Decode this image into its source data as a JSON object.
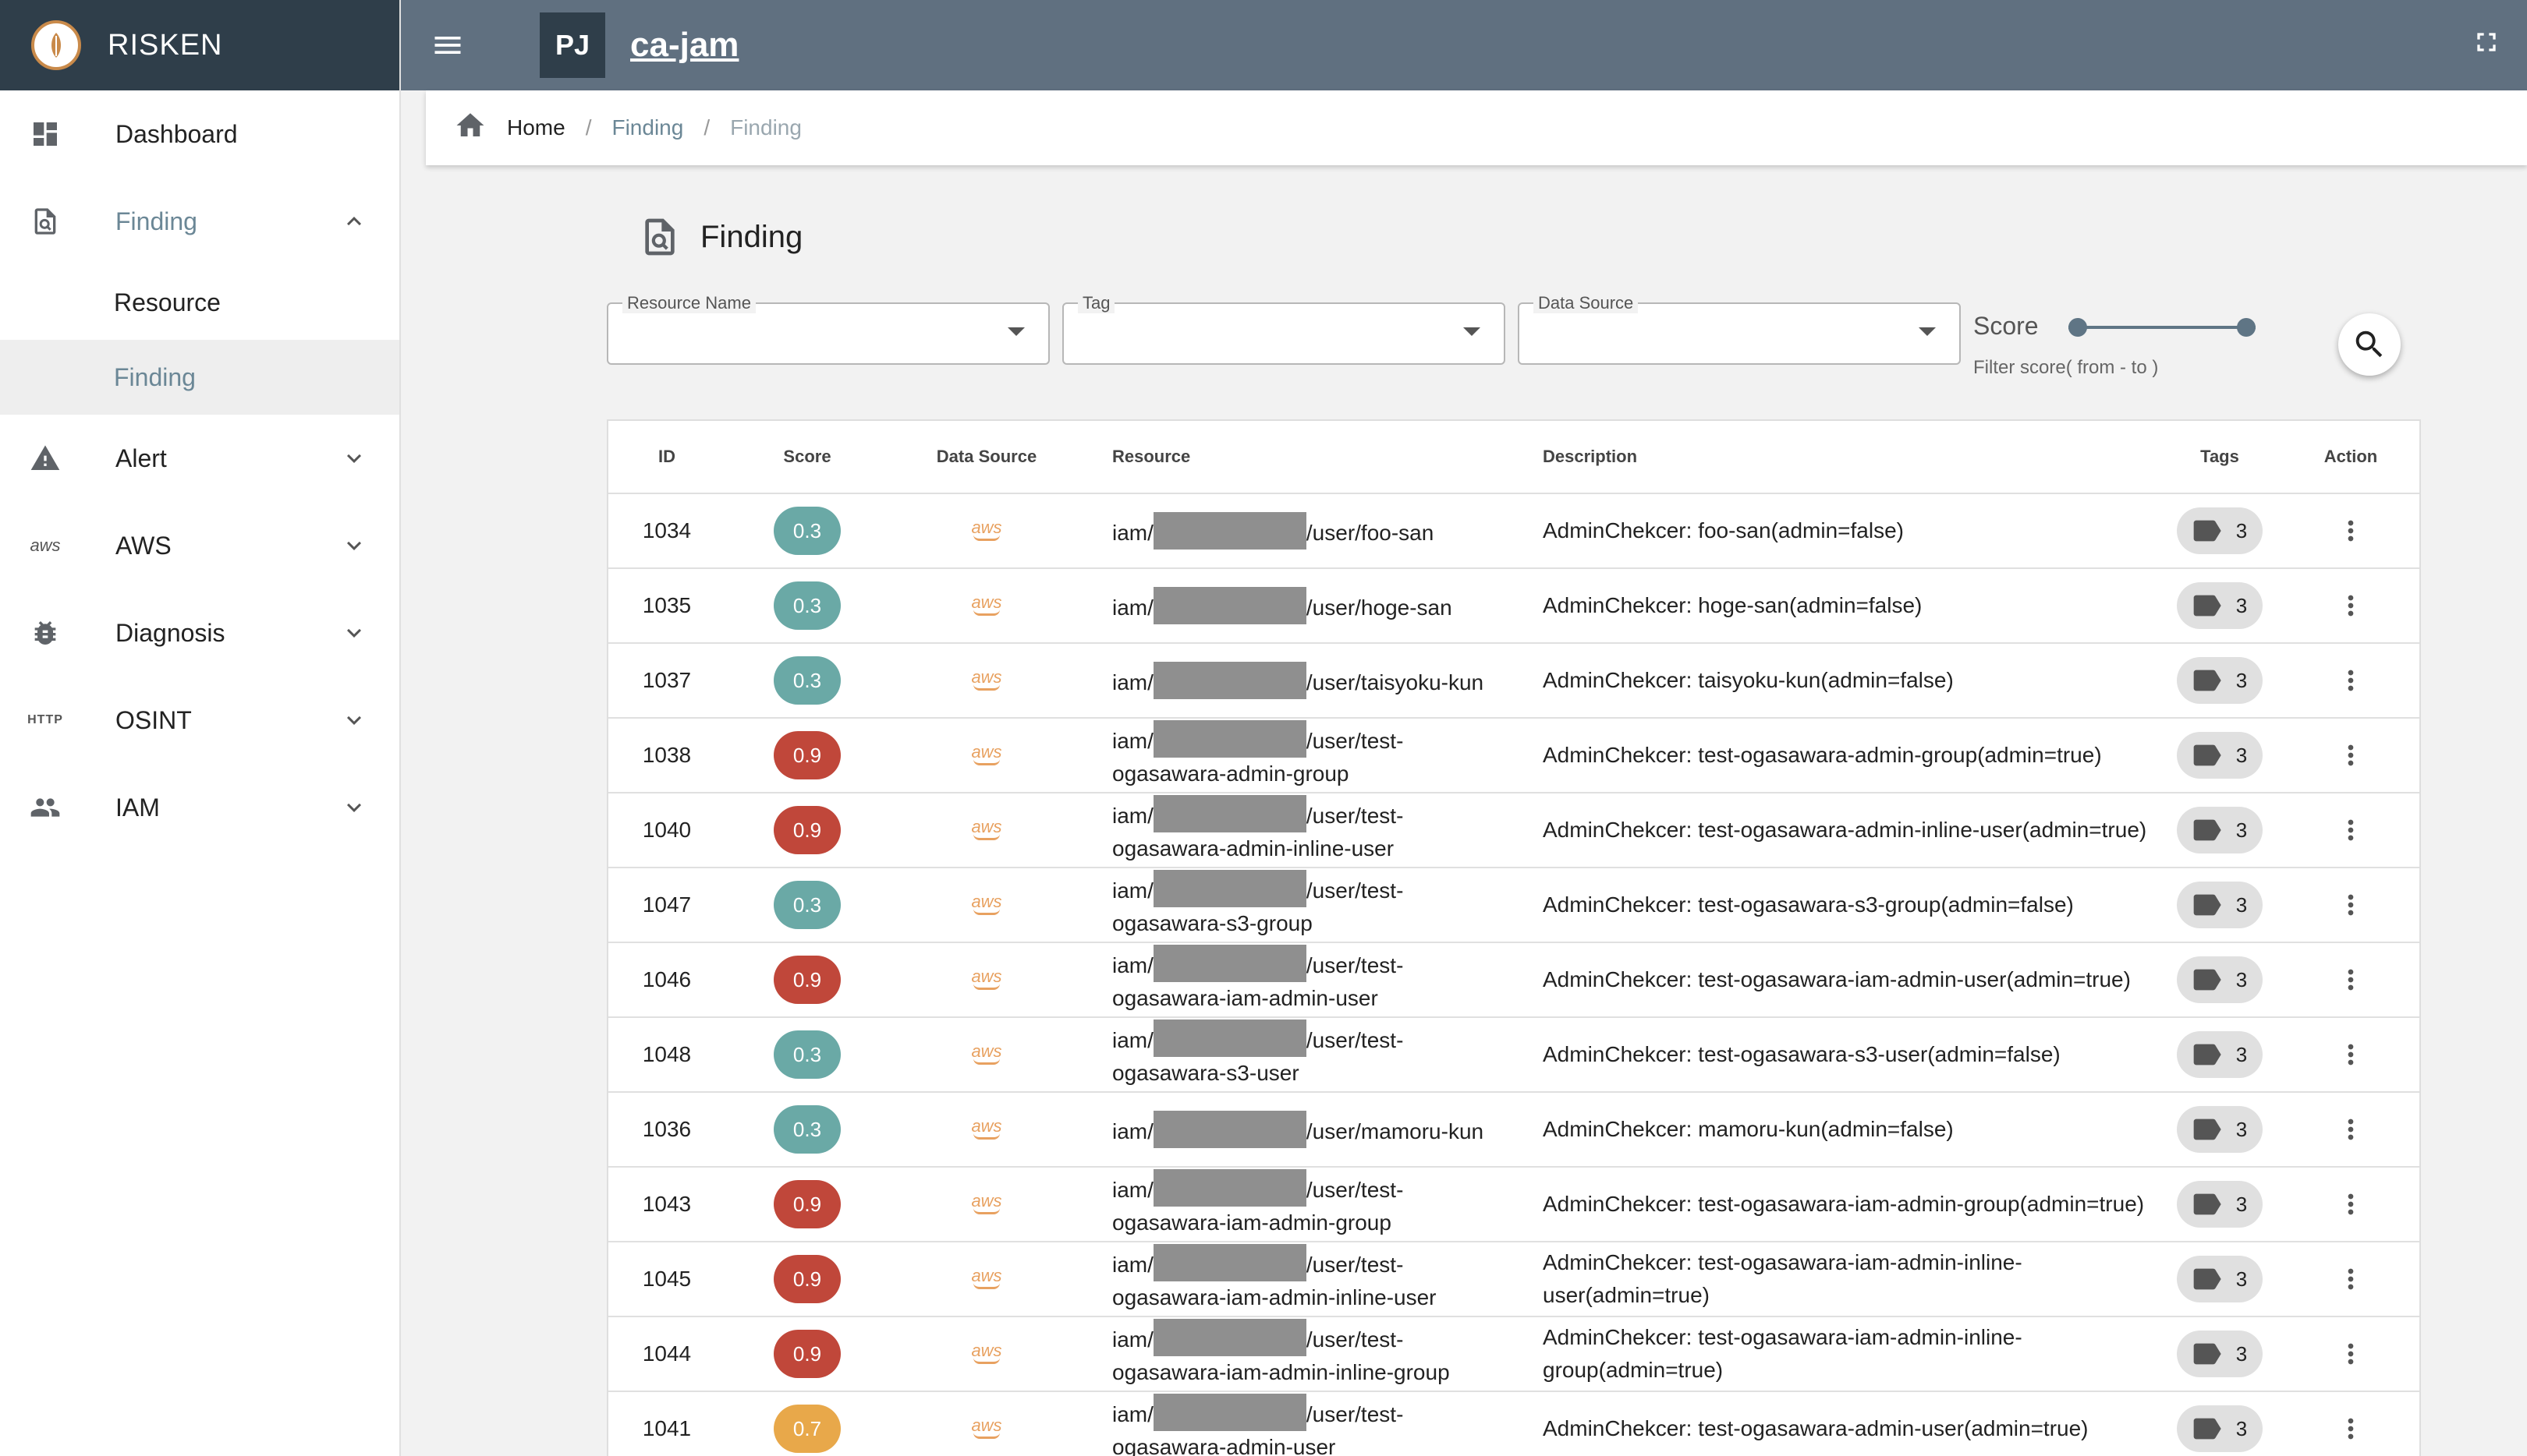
{
  "app": {
    "name": "RISKEN"
  },
  "topbar": {
    "project_badge": "PJ",
    "project_name": "ca-jam"
  },
  "sidebar": {
    "items": [
      {
        "label": "Dashboard",
        "icon": "dashboard-icon"
      },
      {
        "label": "Finding",
        "icon": "finding-icon",
        "expanded": true,
        "children": [
          {
            "label": "Resource"
          },
          {
            "label": "Finding",
            "selected": true
          }
        ]
      },
      {
        "label": "Alert",
        "icon": "warning-icon"
      },
      {
        "label": "AWS",
        "icon": "aws-icon",
        "icon_text": "aws"
      },
      {
        "label": "Diagnosis",
        "icon": "bug-icon"
      },
      {
        "label": "OSINT",
        "icon": "http-icon",
        "icon_text": "HTTP"
      },
      {
        "label": "IAM",
        "icon": "people-icon"
      }
    ]
  },
  "breadcrumb": {
    "items": [
      "Home",
      "Finding",
      "Finding"
    ],
    "separator": "/"
  },
  "page": {
    "title": "Finding"
  },
  "filters": {
    "resource_name_label": "Resource Name",
    "tag_label": "Tag",
    "data_source_label": "Data Source",
    "score_label": "Score",
    "score_hint": "Filter score( from - to )",
    "score_range": [
      0,
      1
    ]
  },
  "table": {
    "headers": {
      "id": "ID",
      "score": "Score",
      "data_source": "Data Source",
      "resource": "Resource",
      "description": "Description",
      "tags": "Tags",
      "action": "Action"
    },
    "rows": [
      {
        "id": "1034",
        "score": "0.3",
        "level": "low",
        "res_prefix": "iam/",
        "res_suffix": "/user/foo-san",
        "description": "AdminChekcer: foo-san(admin=false)",
        "tags": "3"
      },
      {
        "id": "1035",
        "score": "0.3",
        "level": "low",
        "res_prefix": "iam/",
        "res_suffix": "/user/hoge-san",
        "description": "AdminChekcer: hoge-san(admin=false)",
        "tags": "3"
      },
      {
        "id": "1037",
        "score": "0.3",
        "level": "low",
        "res_prefix": "iam/",
        "res_suffix": "/user/taisyoku-kun",
        "description": "AdminChekcer: taisyoku-kun(admin=false)",
        "tags": "3"
      },
      {
        "id": "1038",
        "score": "0.9",
        "level": "high",
        "res_prefix": "iam/",
        "res_suffix": "/user/test-ogasawara-admin-group",
        "description": "AdminChekcer: test-ogasawara-admin-group(admin=true)",
        "tags": "3"
      },
      {
        "id": "1040",
        "score": "0.9",
        "level": "high",
        "res_prefix": "iam/",
        "res_suffix": "/user/test-ogasawara-admin-inline-user",
        "description": "AdminChekcer: test-ogasawara-admin-inline-user(admin=true)",
        "tags": "3"
      },
      {
        "id": "1047",
        "score": "0.3",
        "level": "low",
        "res_prefix": "iam/",
        "res_suffix": "/user/test-ogasawara-s3-group",
        "description": "AdminChekcer: test-ogasawara-s3-group(admin=false)",
        "tags": "3"
      },
      {
        "id": "1046",
        "score": "0.9",
        "level": "high",
        "res_prefix": "iam/",
        "res_suffix": "/user/test-ogasawara-iam-admin-user",
        "description": "AdminChekcer: test-ogasawara-iam-admin-user(admin=true)",
        "tags": "3"
      },
      {
        "id": "1048",
        "score": "0.3",
        "level": "low",
        "res_prefix": "iam/",
        "res_suffix": "/user/test-ogasawara-s3-user",
        "description": "AdminChekcer: test-ogasawara-s3-user(admin=false)",
        "tags": "3"
      },
      {
        "id": "1036",
        "score": "0.3",
        "level": "low",
        "res_prefix": "iam/",
        "res_suffix": "/user/mamoru-kun",
        "description": "AdminChekcer: mamoru-kun(admin=false)",
        "tags": "3"
      },
      {
        "id": "1043",
        "score": "0.9",
        "level": "high",
        "res_prefix": "iam/",
        "res_suffix": "/user/test-ogasawara-iam-admin-group",
        "description": "AdminChekcer: test-ogasawara-iam-admin-group(admin=true)",
        "tags": "3"
      },
      {
        "id": "1045",
        "score": "0.9",
        "level": "high",
        "res_prefix": "iam/",
        "res_suffix": "/user/test-ogasawara-iam-admin-inline-user",
        "description": "AdminChekcer: test-ogasawara-iam-admin-inline-user(admin=true)",
        "tags": "3"
      },
      {
        "id": "1044",
        "score": "0.9",
        "level": "high",
        "res_prefix": "iam/",
        "res_suffix": "/user/test-ogasawara-iam-admin-inline-group",
        "description": "AdminChekcer: test-ogasawara-iam-admin-inline-group(admin=true)",
        "tags": "3"
      },
      {
        "id": "1041",
        "score": "0.7",
        "level": "mid",
        "res_prefix": "iam/",
        "res_suffix": "/user/test-ogasawara-admin-user",
        "description": "AdminChekcer: test-ogasawara-admin-user(admin=true)",
        "tags": "3"
      }
    ]
  },
  "data_source_icon_text": "aws",
  "colors": {
    "header": "#607080",
    "brand": "#2f3e4a",
    "score_low": "#6aa9a6",
    "score_mid": "#e8a84a",
    "score_high": "#c0473a",
    "accent": "#6b8796",
    "aws": "#e8a160"
  }
}
